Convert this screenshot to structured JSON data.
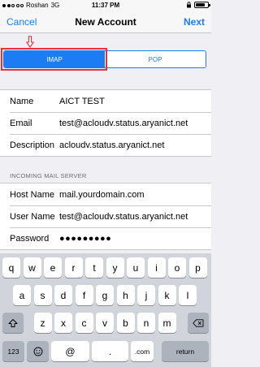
{
  "status_bar": {
    "carrier": "Roshan",
    "network": "3G",
    "time": "11:37 PM"
  },
  "nav": {
    "cancel_label": "Cancel",
    "title": "New Account",
    "next_label": "Next"
  },
  "segment": {
    "options": [
      "IMAP",
      "POP"
    ],
    "selected": "IMAP"
  },
  "account_fields": [
    {
      "label": "Name",
      "value": "AICT TEST"
    },
    {
      "label": "Email",
      "value": "test@acloudv.status.aryanict.net"
    },
    {
      "label": "Description",
      "value": "acloudv.status.aryanict.net"
    }
  ],
  "incoming_header": "INCOMING MAIL SERVER",
  "incoming_fields": [
    {
      "label": "Host Name",
      "value": "mail.yourdomain.com"
    },
    {
      "label": "User Name",
      "value": "test@acloudv.status.aryanict.net"
    },
    {
      "label": "Password",
      "value": "●●●●●●●●●"
    }
  ],
  "keyboard": {
    "row1": [
      "q",
      "w",
      "e",
      "r",
      "t",
      "y",
      "u",
      "i",
      "o",
      "p"
    ],
    "row2": [
      "a",
      "s",
      "d",
      "f",
      "g",
      "h",
      "j",
      "k",
      "l"
    ],
    "row3": [
      "z",
      "x",
      "c",
      "v",
      "b",
      "n",
      "m"
    ],
    "numbers_key": "123",
    "at_key": "@",
    "period_key": ".",
    "com_key": ".com",
    "return_key": "return"
  },
  "colors": {
    "accent": "#1c7cf4",
    "annotation": "#e8313a"
  }
}
